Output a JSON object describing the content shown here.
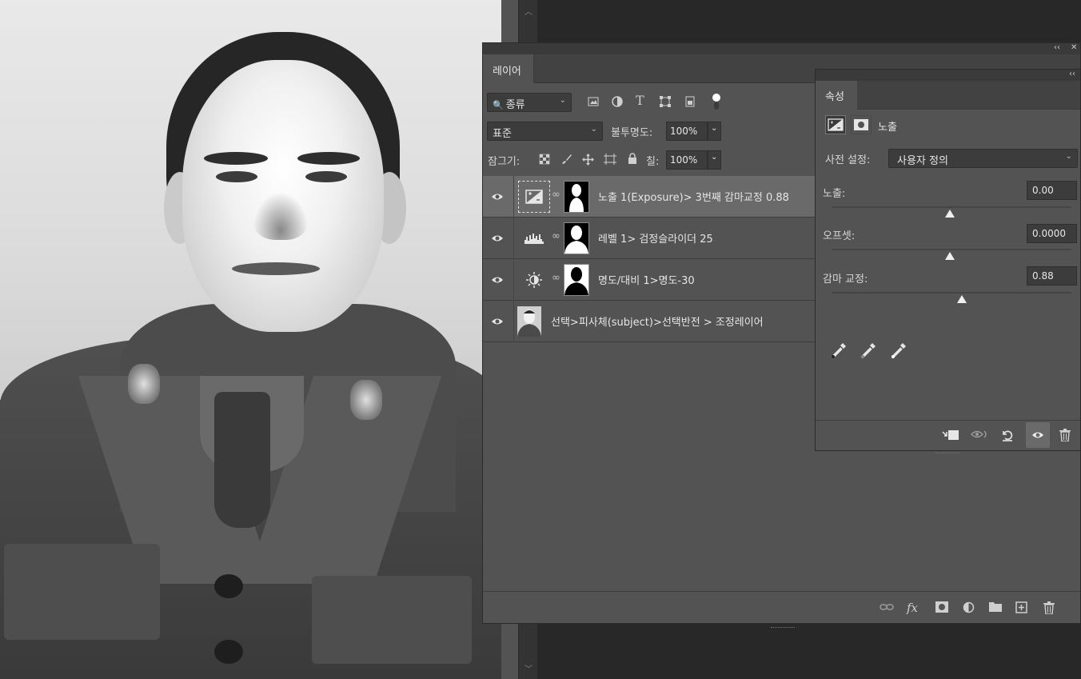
{
  "layers_panel": {
    "tab_label": "레이어",
    "collapse_glyph": "‹‹",
    "close_glyph": "✕",
    "filter_kind_label": "종류",
    "blend_mode": "표준",
    "opacity_label": "불투명도:",
    "opacity_value": "100%",
    "lock_label": "잠그기:",
    "fill_label": "칠:",
    "fill_value": "100%",
    "layers": [
      {
        "name": "노출 1(Exposure)> 3번째 감마교정 0.88",
        "type": "exposure",
        "selected": true
      },
      {
        "name": "레벨 1> 검정슬라이더 25",
        "type": "levels",
        "selected": false
      },
      {
        "name": "명도/대비 1>명도-30",
        "type": "brightness",
        "selected": false
      },
      {
        "name": "선택>피사체(subject)>선택반전 > 조정레이어",
        "type": "photo",
        "selected": false
      }
    ]
  },
  "properties_panel": {
    "tab_label": "속성",
    "adjustment_name": "노출",
    "preset_label": "사전 설정:",
    "preset_value": "사용자 정의",
    "exposure_label": "노출:",
    "exposure_value": "0.00",
    "offset_label": "오프셋:",
    "offset_value": "0.0000",
    "gamma_label": "감마 교정:",
    "gamma_value": "0.88"
  },
  "colors": {
    "panel_bg": "#535353",
    "panel_dark": "#424242",
    "selected_row": "#6a6a6a",
    "workspace": "#282828"
  }
}
